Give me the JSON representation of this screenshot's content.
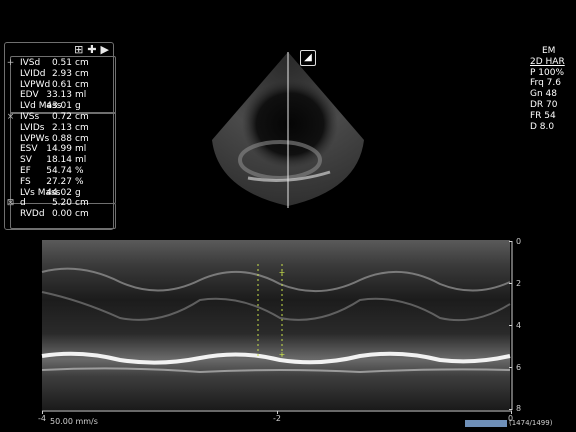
{
  "toolbar": {
    "doc_icon": "⊞",
    "add_icon": "✚",
    "play_icon": "▶"
  },
  "measurements": [
    {
      "marker": "+",
      "label": "IVSd",
      "value": "0.51",
      "unit": "cm"
    },
    {
      "marker": "",
      "label": "LVIDd",
      "value": "2.93",
      "unit": "cm"
    },
    {
      "marker": "",
      "label": "LVPWd",
      "value": "0.61",
      "unit": "cm"
    },
    {
      "marker": "",
      "label": "EDV",
      "value": "33.13",
      "unit": "ml"
    },
    {
      "marker": "",
      "label": "LVd Mass",
      "value": "43.01",
      "unit": "g"
    },
    {
      "marker": "×",
      "label": "IVSs",
      "value": "0.72",
      "unit": "cm"
    },
    {
      "marker": "",
      "label": "LVIDs",
      "value": "2.13",
      "unit": "cm"
    },
    {
      "marker": "",
      "label": "LVPWs",
      "value": "0.88",
      "unit": "cm"
    },
    {
      "marker": "",
      "label": "ESV",
      "value": "14.99",
      "unit": "ml"
    },
    {
      "marker": "",
      "label": "SV",
      "value": "18.14",
      "unit": "ml"
    },
    {
      "marker": "",
      "label": "EF",
      "value": "54.74",
      "unit": "%"
    },
    {
      "marker": "",
      "label": "FS",
      "value": "27.27",
      "unit": "%"
    },
    {
      "marker": "",
      "label": "LVs Mass",
      "value": "44.02",
      "unit": "g"
    },
    {
      "marker": "⊠",
      "label": "d",
      "value": "5.20",
      "unit": "cm"
    },
    {
      "marker": "",
      "label": "RVDd",
      "value": "0.00",
      "unit": "cm"
    }
  ],
  "params": {
    "mode": "EM",
    "preset": "2D HAR",
    "power": "P 100%",
    "freq": "Frq 7.6",
    "gain": "Gn 48",
    "dr": "DR 70",
    "fr": "FR 54",
    "depth": "D 8.0"
  },
  "probe_icon": "◢",
  "depth_ticks": [
    "0",
    "2",
    "4",
    "6",
    "8"
  ],
  "time_ticks": [
    "-4",
    "-2",
    "0"
  ],
  "sweep_speed": "50.00 mm/s",
  "frame_count": "(1474/1499)",
  "colors": {
    "panel_border": "#6f6f6f",
    "caliper": "#c8e04a",
    "frame_bar": "#6e8fb8"
  }
}
